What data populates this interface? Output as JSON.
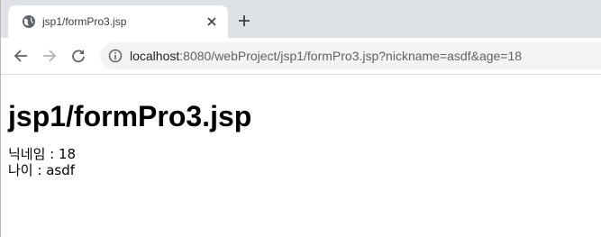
{
  "browser": {
    "tab": {
      "title": "jsp1/formPro3.jsp",
      "favicon": "globe-icon",
      "close_icon": "close-icon"
    },
    "new_tab_icon": "plus-icon",
    "toolbar": {
      "back_icon": "back-arrow-icon",
      "forward_icon": "forward-arrow-icon",
      "reload_icon": "reload-icon",
      "info_icon": "info-icon"
    },
    "address": {
      "host": "localhost",
      "rest": ":8080/webProject/jsp1/formPro3.jsp?nickname=asdf&age=18"
    },
    "colors": {
      "tabstrip_bg": "#dee1e6",
      "omnibox_bg": "#f1f3f4",
      "icon_color": "#5f6368"
    }
  },
  "page": {
    "heading": "jsp1/formPro3.jsp",
    "lines": [
      "닉네임 : 18",
      "나이 : asdf"
    ]
  }
}
